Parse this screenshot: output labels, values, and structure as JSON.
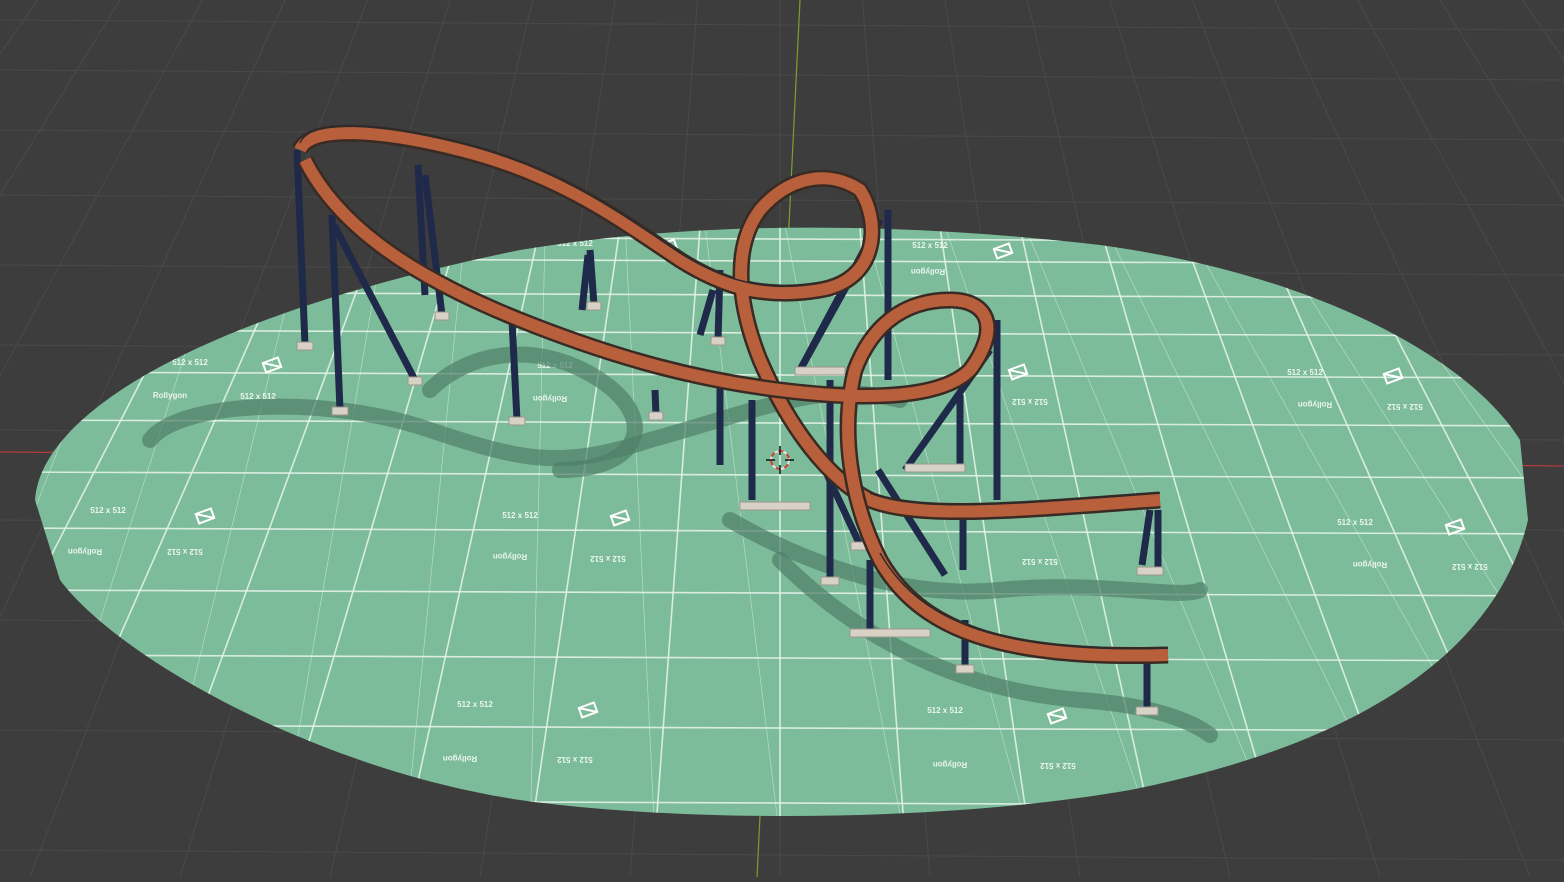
{
  "viewport": {
    "background": "#3d3d3d",
    "grid_color": "#4a4a4a",
    "x_axis_color": "#b03a3a",
    "y_axis_color": "#7aa02a"
  },
  "ground": {
    "color": "#7dbc9a",
    "line_color": "#e8f4ec",
    "texture_labels": {
      "size": "512 x 512",
      "brand": "Rollygon",
      "size_mirrored": "512 x 512",
      "brand_mirrored": "Rollygon"
    }
  },
  "coaster": {
    "track_color": "#b8603c",
    "rail_color": "#3a2a24",
    "support_color": "#1f2a4a",
    "footing_color": "#d8d2c6"
  },
  "gizmo": {
    "icon": "3d-cursor-icon"
  }
}
